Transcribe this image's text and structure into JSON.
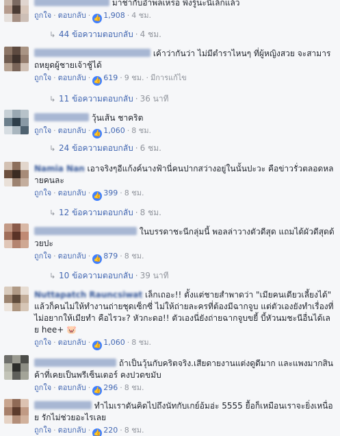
{
  "comments": [
    {
      "author": "โ...",
      "text": "มาช่ากับอำพลเหรอ พึ่งรู้นะนี่เล็กแล้ว",
      "like": "ถูกใจ",
      "reply": "ตอบกลับ",
      "reactions": "1,908",
      "time": "4 ชม.",
      "edited": "",
      "replies": "44 ข้อความตอบกลับ",
      "replies_time": "4 ชม.",
      "avatar": [
        "#c9b7ab",
        "#7b6a62",
        "#e0d5cf",
        "#b59b8d",
        "#4a3b34",
        "#d8c7bb",
        "#e5dfdb",
        "#a58f83",
        "#cdbfb6"
      ]
    },
    {
      "author": "",
      "text": "เค้าว่ากันว่า ไม่มีตำราไหนๆ ที่ผู้หญิงสวย จะสามารถหยุดผู้ชายเจ้าชู้ได้",
      "like": "ถูกใจ",
      "reply": "ตอบกลับ",
      "reactions": "619",
      "time": "9 ชม.",
      "edited": "มีการแก้ไข",
      "replies": "11 ข้อความตอบกลับ",
      "replies_time": "36 นาที",
      "avatar": [
        "#8c7566",
        "#5d4a40",
        "#a99484",
        "#6f5b4f",
        "#3f322c",
        "#947d6e",
        "#b6a292",
        "#7a6559",
        "#d0c0b4"
      ]
    },
    {
      "author": "",
      "text": "วุ้นเส้น ชาคริต",
      "like": "ถูกใจ",
      "reply": "ตอบกลับ",
      "reactions": "1,060",
      "time": "8 ชม.",
      "edited": "",
      "replies": "24 ข้อความตอบกลับ",
      "replies_time": "6 ชม.",
      "avatar": [
        "#c7d0d6",
        "#9aa8b2",
        "#b7c2c9",
        "#6c7f8c",
        "#2e3e4a",
        "#8999a5",
        "#d6dde2",
        "#a9b6bf",
        "#4f6270"
      ]
    },
    {
      "author": "Namia Nan",
      "text": "เอาจริงๆอีแก้งค์นางฟ้านี่คนปากสว่างอยู่ในนั้นปะวะ คือข่าวรั่วตลอดหลายคนละ",
      "like": "ถูกใจ",
      "reply": "ตอบกลับ",
      "reactions": "399",
      "time": "8 ชม.",
      "edited": "",
      "replies": "12 ข้อความตอบกลับ",
      "replies_time": "8 ชม.",
      "avatar": [
        "#d3c1b3",
        "#8c6f5c",
        "#e2d6cc",
        "#6b4f3e",
        "#3b2b22",
        "#a78b78",
        "#e9e0d8",
        "#9d8371",
        "#c4ae9e"
      ]
    },
    {
      "author": "",
      "text": "ในบรรดาชะนีกลุ่มนี้ พอลล่าวางตัวดีสุด แถมได้ผัวดีสุดด้วยปะ",
      "like": "ถูกใจ",
      "reply": "ตอบกลับ",
      "reactions": "879",
      "time": "8 ชม.",
      "edited": "",
      "replies": "10 ข้อความตอบกลับ",
      "replies_time": "39 นาที",
      "avatar": [
        "#c39a86",
        "#8a5b4a",
        "#d8b8a6",
        "#a06e5a",
        "#5a3327",
        "#c08a74",
        "#e0c6b7",
        "#b48470",
        "#cfa893"
      ]
    },
    {
      "author": "Nuttapatch Rauncsiwat",
      "text": "เล็กเถอะ!! ตั้งแต่ชายสำพาดว่า \"เมียคนเดียวเลี้ยงได้\" แล้วก็คนไม่ให้ทำงานถ่ายชุดเซ็กซี่ ไม่ให้ถ่ายละครที่ต้องมีฉากจูบ แต่ตัวเองยังทำเรื่องที่ไม่อยากให้เมียทำ คือไรวะ? หัวกะดอ!! ตัวเองนี่ยังถ่ายฉากจูบขยี้ บี้หัวนมชะนีอื่นได้เลย hee+ 🐷",
      "like": "ถูกใจ",
      "reply": "ตอบกลับ",
      "reactions": "1,060",
      "time": "8 ชม.",
      "edited": "",
      "replies": "",
      "replies_time": "",
      "avatar": [
        "#d9cbbd",
        "#b09a86",
        "#e7ddd3",
        "#9c8470",
        "#5f4b3b",
        "#c2ad99",
        "#ece4dc",
        "#ad957f",
        "#d6c6b6"
      ]
    },
    {
      "author": "",
      "text": "ถ้าเป็นวุ้นกับคริตจริง.เสียดายงานแต่งดูดีมาก และแพงมากสินค้าที่เคยเป็นพรีเซ็นเตอร์ คงปวดขมับ",
      "like": "ถูกใจ",
      "reply": "ตอบกลับ",
      "reactions": "296",
      "time": "8 ชม.",
      "edited": "",
      "replies": "",
      "replies_time": "",
      "avatar": [
        "#6d6e6a",
        "#9a9a90",
        "#4c4d49",
        "#b5b6aa",
        "#2d2e2b",
        "#8c8d84",
        "#c3c4b8",
        "#5e5f5a",
        "#a3a498"
      ]
    },
    {
      "author": "",
      "text": "ทำไมเราดันคิดไปถึงนัทกับเกย์อ้มอ่ะ 5555 ยื้อก็เหมือนเราจะยิ่งเหนื่อย รักไม่ช่วยอะไรเลย",
      "like": "ถูกใจ",
      "reply": "ตอบกลับ",
      "reactions": "220",
      "time": "8 ชม.",
      "edited": "",
      "replies": "",
      "replies_time": "",
      "avatar": [
        "#c8a58f",
        "#8f6a56",
        "#dcc2b1",
        "#a7806b",
        "#5c3b2c",
        "#c09a84",
        "#e5d2c4",
        "#b38e79",
        "#d1b19c"
      ]
    }
  ],
  "colors": {
    "link": "#4267b2",
    "author": "#365899",
    "muted": "#90949c",
    "background": "#f6f7f9",
    "like_icon": "#4080ff"
  },
  "icons": {
    "like": "thumbs-up-icon",
    "reply_arrow": "reply-arrow-icon"
  }
}
